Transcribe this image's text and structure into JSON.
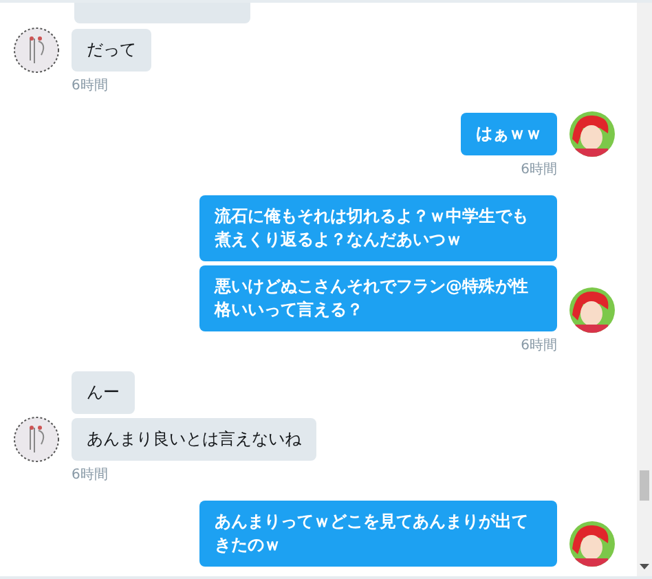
{
  "groups": [
    {
      "kind": "received",
      "messages": [
        "だって"
      ],
      "time": "6時間"
    },
    {
      "kind": "sent",
      "messages": [
        "はぁｗｗ"
      ],
      "time": "6時間"
    },
    {
      "kind": "sent",
      "messages": [
        "流石に俺もそれは切れるよ？ｗ中学生でも煮えくり返るよ？なんだあいつｗ",
        "悪いけどぬこさんそれでフラン@特殊が性格いいって言える？"
      ],
      "time": "6時間"
    },
    {
      "kind": "received",
      "messages": [
        "んー",
        "あんまり良いとは言えないね"
      ],
      "time": "6時間"
    },
    {
      "kind": "sent",
      "messages": [
        "あんまりってｗどこを見てあんまりが出てきたのｗ"
      ]
    }
  ]
}
